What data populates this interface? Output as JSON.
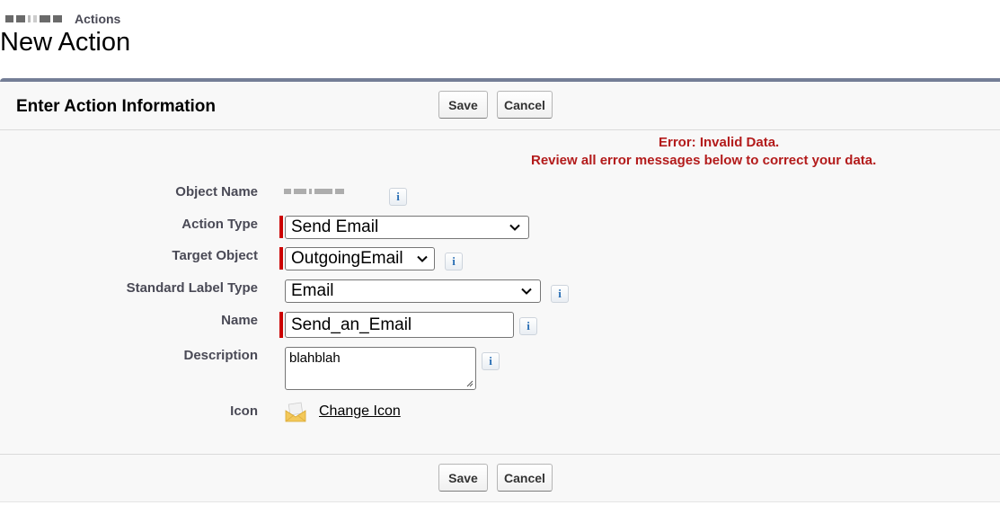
{
  "header": {
    "breadcrumb_label": "Actions",
    "title": "New Action"
  },
  "panel": {
    "title": "Enter Action Information",
    "buttons": {
      "save": "Save",
      "cancel": "Cancel"
    }
  },
  "errors": {
    "line1": "Error: Invalid Data.",
    "line2": "Review all error messages below to correct your data."
  },
  "form": {
    "object_name": {
      "label": "Object Name",
      "value_redacted": true
    },
    "action_type": {
      "label": "Action Type",
      "value": "Send Email",
      "required": true
    },
    "target_object": {
      "label": "Target Object",
      "value": "OutgoingEmail",
      "required": true
    },
    "standard_label_type": {
      "label": "Standard Label Type",
      "value": "Email"
    },
    "name": {
      "label": "Name",
      "value": "Send_an_Email",
      "required": true
    },
    "description": {
      "label": "Description",
      "value": "blahblah"
    },
    "icon": {
      "label": "Icon",
      "icon": "envelope-icon",
      "link": "Change Icon"
    }
  },
  "footer": {
    "buttons": {
      "save": "Save",
      "cancel": "Cancel"
    }
  },
  "colors": {
    "error": "#b31b1b",
    "required_bar": "#cc0000",
    "panel_top_border": "#747e96",
    "info_icon": "#2a6fb5"
  }
}
